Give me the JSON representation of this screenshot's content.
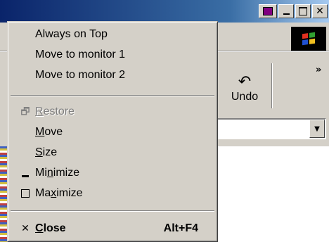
{
  "window": {
    "extra_button_name": "always-on-top-button",
    "menu_items_hidden": true
  },
  "toolbar": {
    "undo_label": "Undo",
    "chevron": "»"
  },
  "address": {
    "dropdown_arrow": "▼"
  },
  "sysmenu": {
    "always_on_top": "Always on Top",
    "monitor1": "Move to monitor 1",
    "monitor2": "Move to monitor 2",
    "restore": {
      "pre": "",
      "mnemonic": "R",
      "post": "estore"
    },
    "move": {
      "pre": "",
      "mnemonic": "M",
      "post": "ove"
    },
    "size": {
      "pre": "",
      "mnemonic": "S",
      "post": "ize"
    },
    "minimize": {
      "pre": "Mi",
      "mnemonic": "n",
      "post": "imize"
    },
    "maximize": {
      "pre": "Ma",
      "mnemonic": "x",
      "post": "imize"
    },
    "close": {
      "pre": "",
      "mnemonic": "C",
      "post": "lose",
      "accelerator": "Alt+F4"
    }
  },
  "icons": {
    "close_glyph": "✕",
    "restore_glyph": "🗗",
    "undo_glyph": "↶"
  },
  "colors": {
    "menu_bg": "#d4d0c8",
    "title_start": "#0a246a",
    "title_end": "#a6caf0",
    "disabled_text": "#808080"
  }
}
